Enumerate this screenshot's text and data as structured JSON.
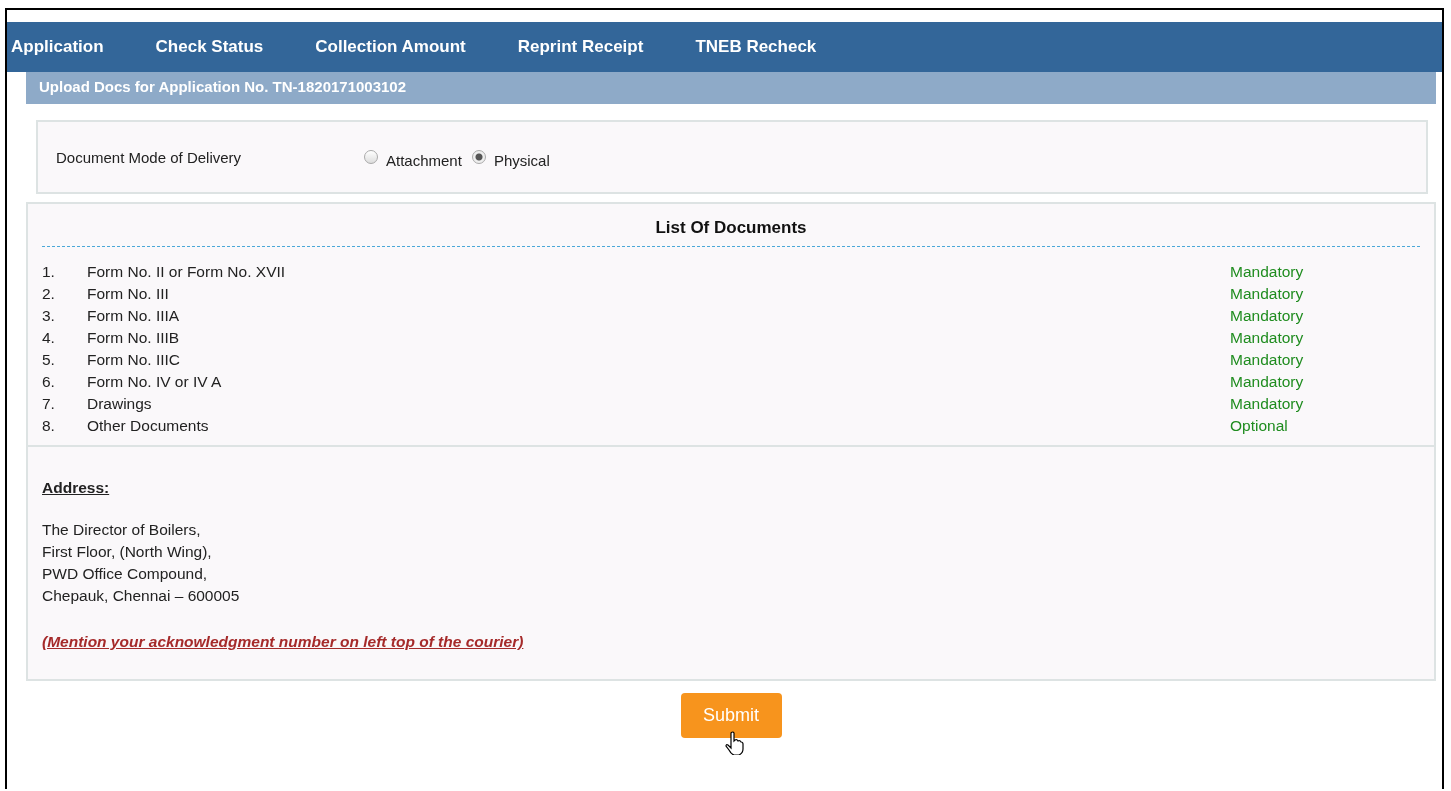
{
  "nav": [
    {
      "label": "Application"
    },
    {
      "label": "Check Status"
    },
    {
      "label": "Collection Amount"
    },
    {
      "label": "Reprint Receipt"
    },
    {
      "label": "TNEB Recheck"
    }
  ],
  "header": "Upload Docs for Application No. TN-1820171003102",
  "delivery": {
    "label": "Document Mode of Delivery",
    "options": [
      {
        "label": "Attachment",
        "selected": false
      },
      {
        "label": "Physical",
        "selected": true
      }
    ]
  },
  "documents": {
    "title": "List Of Documents",
    "items": [
      {
        "number": "1.",
        "name": "Form No. II or Form No. XVII",
        "requirement": "Mandatory"
      },
      {
        "number": "2.",
        "name": "Form No. III",
        "requirement": "Mandatory"
      },
      {
        "number": "3.",
        "name": "Form No. IIIA",
        "requirement": "Mandatory"
      },
      {
        "number": "4.",
        "name": "Form No. IIIB",
        "requirement": "Mandatory"
      },
      {
        "number": "5.",
        "name": "Form No. IIIC",
        "requirement": "Mandatory"
      },
      {
        "number": "6.",
        "name": "Form No. IV or IV A",
        "requirement": "Mandatory"
      },
      {
        "number": "7.",
        "name": "Drawings",
        "requirement": "Mandatory"
      },
      {
        "number": "8.",
        "name": "Other Documents",
        "requirement": "Optional"
      }
    ]
  },
  "address": {
    "heading": "Address:",
    "lines": [
      "The Director of Boilers,",
      "First Floor, (North Wing),",
      "PWD Office Compound,",
      "Chepauk, Chennai – 600005"
    ],
    "note": "(Mention your acknowledgment number on left top of the courier)"
  },
  "submit": "Submit"
}
